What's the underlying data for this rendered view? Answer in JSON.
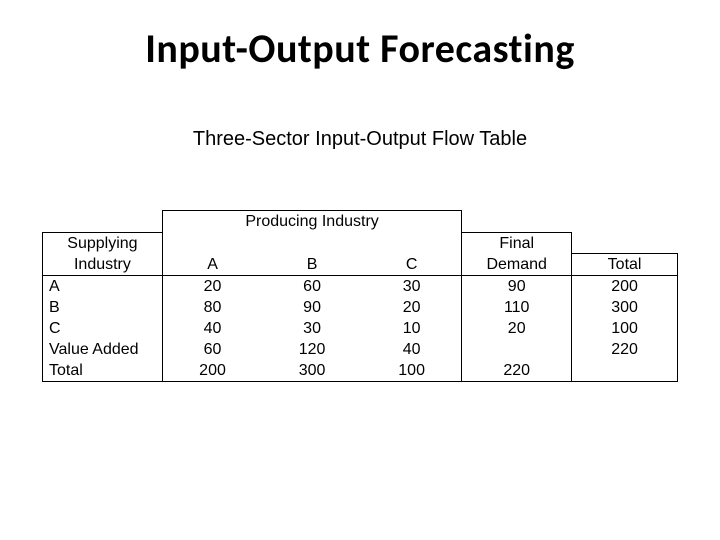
{
  "title": "Input-Output Forecasting",
  "subtitle": "Three-Sector Input-Output Flow Table",
  "headers": {
    "producing": "Producing Industry",
    "supplying_line1": "Supplying",
    "supplying_line2": "Industry",
    "a": "A",
    "b": "B",
    "c": "C",
    "final_line1": "Final",
    "final_line2": "Demand",
    "total": "Total"
  },
  "rows": [
    {
      "label": "A",
      "a": "20",
      "b": "60",
      "c": "30",
      "final": "90",
      "total": "200"
    },
    {
      "label": "B",
      "a": "80",
      "b": "90",
      "c": "20",
      "final": "110",
      "total": "300"
    },
    {
      "label": "C",
      "a": "40",
      "b": "30",
      "c": "10",
      "final": "20",
      "total": "100"
    },
    {
      "label": "Value Added",
      "a": "60",
      "b": "120",
      "c": "40",
      "final": "",
      "total": "220"
    },
    {
      "label": "Total",
      "a": "200",
      "b": "300",
      "c": "100",
      "final": "220",
      "total": ""
    }
  ],
  "chart_data": {
    "type": "table",
    "title": "Three-Sector Input-Output Flow Table",
    "columns": [
      "Supplying Industry",
      "A",
      "B",
      "C",
      "Final Demand",
      "Total"
    ],
    "data": [
      [
        "A",
        20,
        60,
        30,
        90,
        200
      ],
      [
        "B",
        80,
        90,
        20,
        110,
        300
      ],
      [
        "C",
        40,
        30,
        10,
        20,
        100
      ],
      [
        "Value Added",
        60,
        120,
        40,
        null,
        220
      ],
      [
        "Total",
        200,
        300,
        100,
        220,
        null
      ]
    ]
  }
}
